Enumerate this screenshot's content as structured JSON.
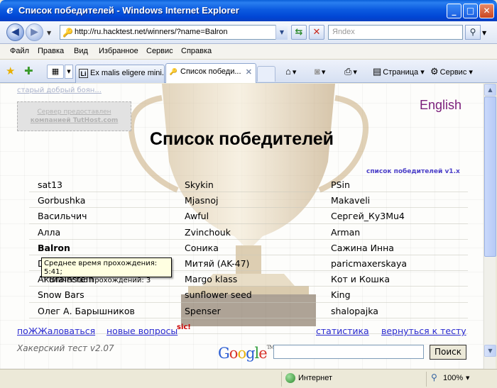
{
  "window": {
    "title": "Список победителей - Windows Internet Explorer",
    "controls": [
      "_",
      "□",
      "✕"
    ]
  },
  "address_bar": {
    "back_glyph": "◀",
    "forward_glyph": "▶",
    "url": "http://ru.hacktest.net/winners/?name=Balron",
    "search_placeholder": "Яndex"
  },
  "menu": {
    "items": [
      "Файл",
      "Правка",
      "Вид",
      "Избранное",
      "Сервис",
      "Справка"
    ]
  },
  "tabs": [
    {
      "label": "Ex malis eligere mini...",
      "icon": "Li",
      "active": false
    },
    {
      "label": "Список победи...",
      "icon": "key",
      "active": true
    }
  ],
  "command_bar": {
    "page_label": "Страница",
    "tools_label": "Сервис"
  },
  "page": {
    "old_link": "старый добрый боян...",
    "host_line1": "Сервер предоставлен",
    "host_line2": "компанией TutHost.com",
    "lang_link": "English",
    "title": "Список победителей",
    "version_link": "список победителей v1.x",
    "winners": [
      [
        "sat13",
        "Skykin",
        "PSin"
      ],
      [
        "Gorbushka",
        "Mjasnoj",
        "Makaveli"
      ],
      [
        "Васильчич",
        "Awful",
        "Сергей_Ку3Мu4"
      ],
      [
        "Алла",
        "Zvinchouk",
        "Arman"
      ],
      [
        "Balron",
        "Соника",
        "Сажина Инна"
      ],
      [
        "D",
        "Митяй (AK-47)",
        "paricmaxerskaya"
      ],
      [
        "Al Brainstein",
        "Margo klass",
        "Кот и Кошка"
      ],
      [
        "Snow Bars",
        "sunflower seed",
        "King"
      ],
      [
        "Олег А. Барышников",
        "Spenser",
        "shalopajka"
      ],
      [
        "",
        "",
        ""
      ]
    ],
    "highlighted_winner": "Balron",
    "tooltip_line1": "Среднее время прохождения: 5:41;",
    "tooltip_line2": "Количество прохождений: 3",
    "bottom_links": {
      "complain": "поЖЖаловаться",
      "new_questions": "новые вопросы",
      "sic": "sic!",
      "stats": "статистика",
      "back_to_test": "вернуться к тесту"
    },
    "hack_version": "Хакерский тест v2.07",
    "google_logo": [
      "G",
      "o",
      "o",
      "g",
      "l",
      "e"
    ],
    "google_tm": "TM",
    "search_button": "Поиск"
  },
  "status_bar": {
    "zone": "Интернет",
    "zoom": "100%"
  },
  "colors": {
    "titlebar": "#0a5fd9",
    "link": "#2a2ad0",
    "lang_link": "#7a1d7a",
    "version_link": "#4a3ec8",
    "sic": "#cc0000",
    "tooltip_bg": "#ffffe1"
  }
}
